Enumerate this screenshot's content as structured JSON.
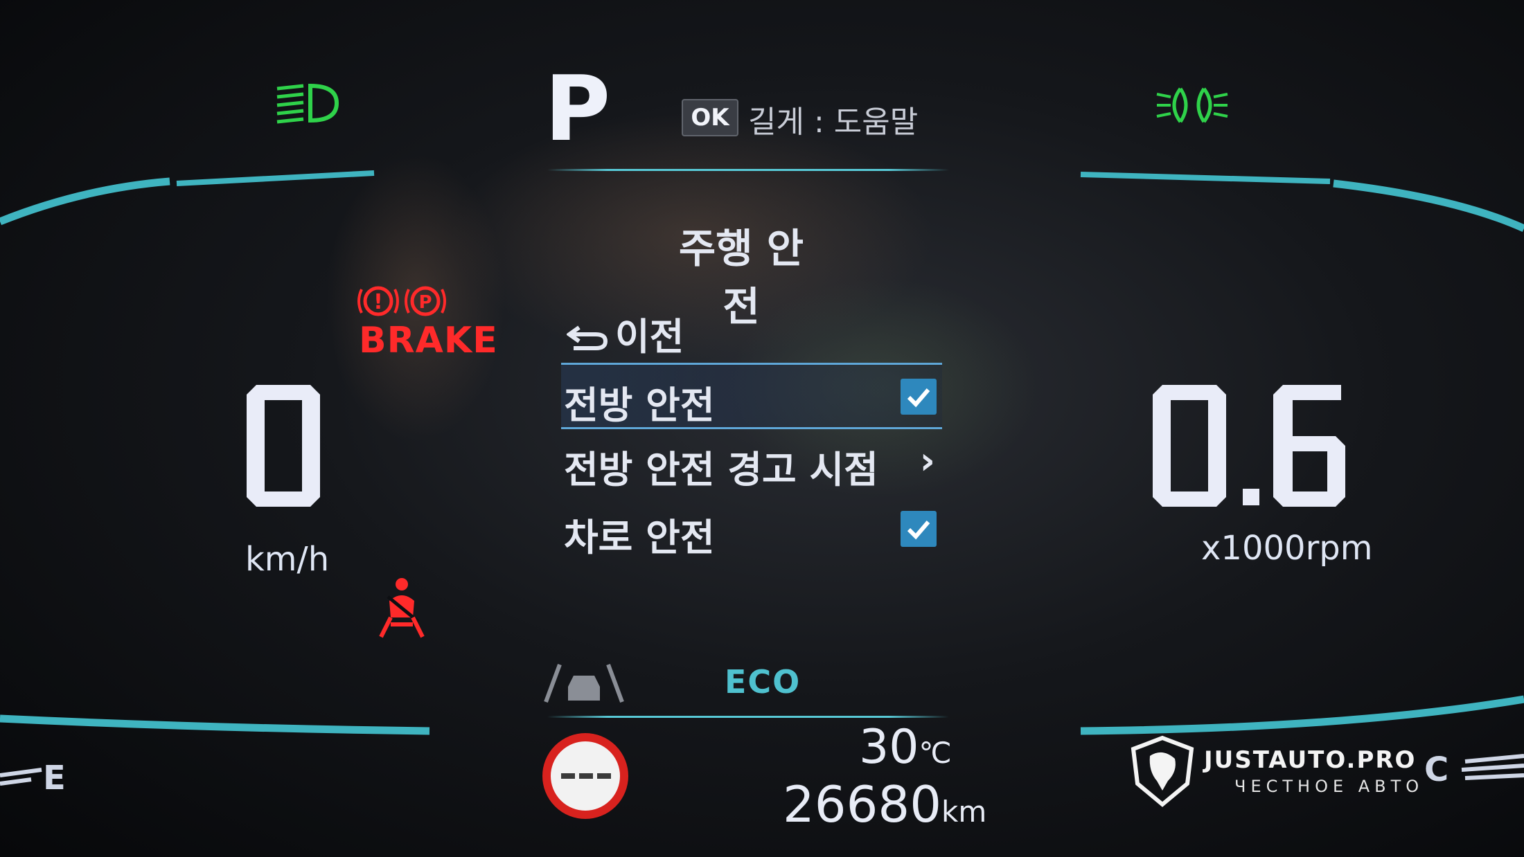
{
  "gear": "P",
  "header": {
    "ok_badge": "OK",
    "hint": "길게 : 도움말"
  },
  "menu": {
    "title": "주행 안전",
    "back_label": "이전",
    "items": [
      {
        "label": "전방 안전",
        "control": "checkbox",
        "checked": true,
        "selected": true
      },
      {
        "label": "전방 안전 경고 시점",
        "control": "chevron",
        "chevron": "›"
      },
      {
        "label": "차로 안전",
        "control": "checkbox",
        "checked": true
      }
    ]
  },
  "speed": {
    "value": "0",
    "unit": "km/h"
  },
  "tach": {
    "value": "0.6",
    "unit": "x1000rpm"
  },
  "warnings": {
    "brake_label": "BRAKE"
  },
  "drive_mode": "ECO",
  "temperature": {
    "value": "30",
    "unit": "℃"
  },
  "odometer": {
    "value": "26680",
    "unit": "km"
  },
  "fuel_gauge": {
    "label": "E"
  },
  "temp_gauge": {
    "label": "C"
  },
  "watermark": {
    "brand": "JUSTAUTO.PRO",
    "tagline": "ЧЕСТНОЕ АВТО"
  },
  "colors": {
    "accent_teal": "#4fc1cf",
    "warning_red": "#ff2a2a",
    "indicator_green": "#2fd24a",
    "check_blue": "#2e88bd"
  },
  "icons": [
    "low-beam-icon",
    "fog-light-icon",
    "brake-warning-icon",
    "parking-brake-icon",
    "seatbelt-icon",
    "lane-assist-icon",
    "speed-limit-sign-icon",
    "back-arrow-icon",
    "checkmark-icon",
    "chevron-right-icon",
    "lion-logo-icon"
  ]
}
